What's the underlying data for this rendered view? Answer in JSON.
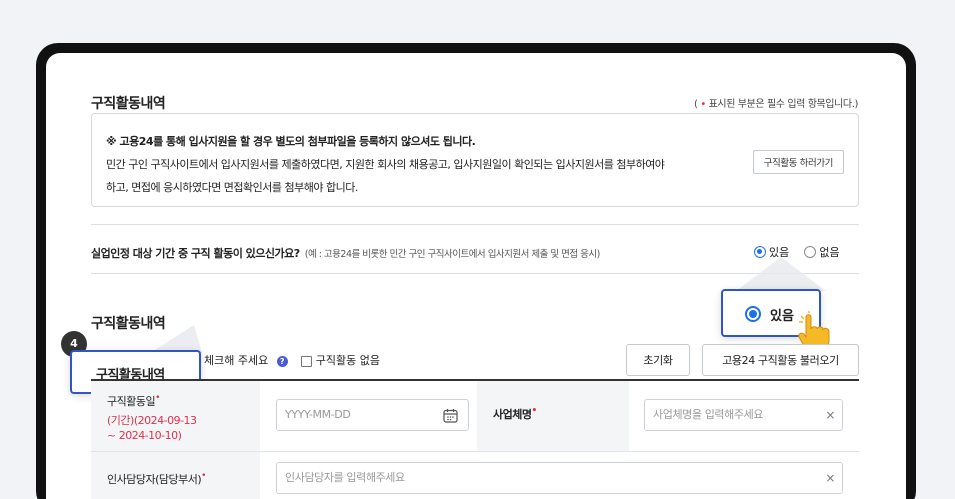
{
  "section": {
    "title": "구직활동내역",
    "required_note_prefix": "( ",
    "required_dot": "•",
    "required_note": " 표시된 부분은 필수 입력 항목입니다.)"
  },
  "info": {
    "line1": "※ 고용24를 통해 입사지원을 할 경우 별도의 첨부파일을 등록하지 않으셔도 됩니다.",
    "line2": "민간 구인 구직사이트에서 입사지원서를 제출하였다면, 지원한 회사의 채용공고, 입사지원일이 확인되는 입사지원서를 첨부하여야",
    "line3": "하고, 면접에 응시하였다면 면접확인서를 첨부해야 합니다.",
    "button": "구직활동 하러가기"
  },
  "question": {
    "text": "실업인정 대상 기간 중 구직 활동이 있으신가요?",
    "example": "(예 : 고용24를 비롯한 민간 구인 구직사이트에서 입사지원서 제출 및 면접 응시)",
    "option_yes": "있음",
    "option_no": "없음",
    "selected": "있음"
  },
  "callout_yes": {
    "label": "있음"
  },
  "step_callout": {
    "number": "4",
    "label": "구직활동내역"
  },
  "activity": {
    "title": "구직활동내역",
    "check_hint": "체크해 주세요",
    "help_mark": "?",
    "no_activity_label": "구직활동 없음",
    "reset_button": "초기화",
    "load_button": "고용24 구직활동 불러오기"
  },
  "form": {
    "date_label": "구직활동일",
    "date_period": "(기간)(2024-09-13",
    "date_period2": "~ 2024-10-10)",
    "date_placeholder": "YYYY-MM-DD",
    "company_label": "사업체명",
    "company_placeholder": "사업체명을 입력해주세요",
    "hr_label": "인사담당자(담당부서)",
    "hr_placeholder": "인사담당자를 입력해주세요",
    "clear_symbol": "×"
  },
  "colors": {
    "accent": "#2f56c8",
    "required": "#e0304a",
    "radio": "#1f6fe8"
  }
}
